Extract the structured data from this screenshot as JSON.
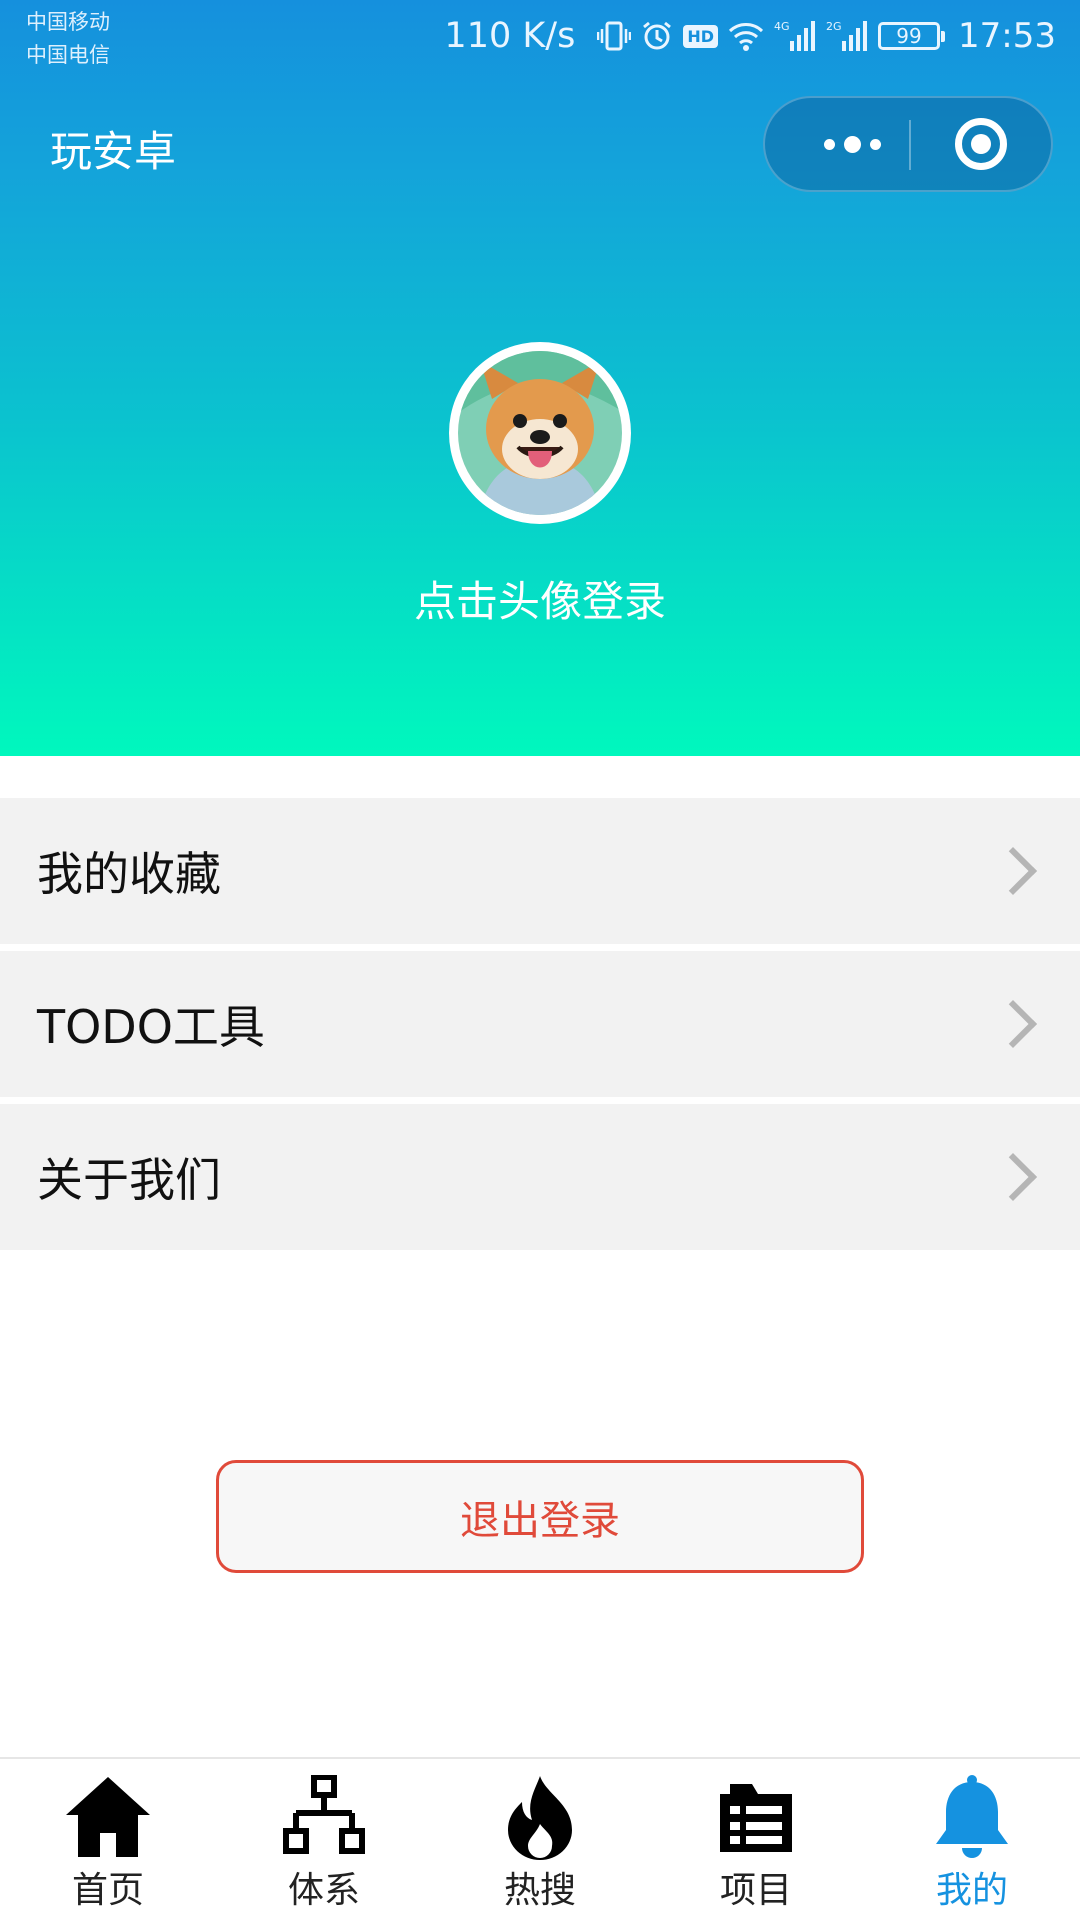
{
  "status_bar": {
    "carrier_1": "中国移动",
    "carrier_2": "中国电信",
    "net_speed": "110 K/s",
    "hd_badge": "HD",
    "signal_1_label": "4G",
    "signal_2_label": "2G",
    "battery": "99",
    "time": "17:53"
  },
  "header": {
    "title": "玩安卓",
    "login_hint": "点击头像登录"
  },
  "menu": {
    "items": [
      {
        "label": "我的收藏"
      },
      {
        "label": "TODO工具"
      },
      {
        "label": "关于我们"
      }
    ]
  },
  "logout": {
    "label": "退出登录"
  },
  "tabbar": {
    "tabs": [
      {
        "label": "首页",
        "icon": "home-icon"
      },
      {
        "label": "体系",
        "icon": "sitemap-icon"
      },
      {
        "label": "热搜",
        "icon": "fire-icon"
      },
      {
        "label": "项目",
        "icon": "list-icon"
      },
      {
        "label": "我的",
        "icon": "bell-icon"
      }
    ],
    "active_index": 4
  },
  "colors": {
    "gradient_top": "#1590dd",
    "gradient_bottom": "#00f8bd",
    "logout_red": "#e04a3a",
    "tab_active": "#1592e0"
  }
}
